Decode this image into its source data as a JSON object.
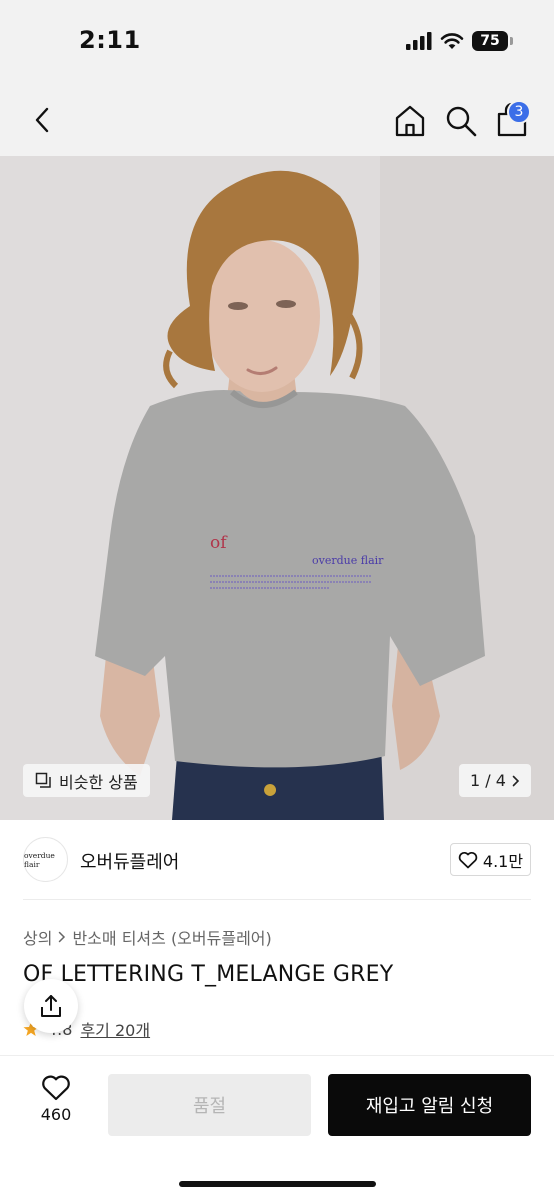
{
  "status_bar": {
    "time": "2:11",
    "battery": "75"
  },
  "nav": {
    "cart_count": "3"
  },
  "hero": {
    "shirt_print_small": "of",
    "shirt_print_brand": "overdue flair",
    "similar_label": "비슷한 상품",
    "counter": "1 / 4"
  },
  "brand": {
    "logo_text": "overdue flair",
    "name": "오버듀플레어",
    "likes": "4.1만"
  },
  "product": {
    "breadcrumb": [
      "상의",
      "반소매 티셔츠 (오버듀플레어)"
    ],
    "title": "OF LETTERING T_MELANGE GREY",
    "rating": "4.8",
    "reviews": "후기 20개"
  },
  "bottom": {
    "wish_count": "460",
    "soldout_label": "품절",
    "restock_label": "재입고 알림 신청"
  },
  "colors": {
    "accent_badge": "#3b6ee8",
    "cta": "#0a0a0a",
    "rating_star": "#f5a623"
  }
}
